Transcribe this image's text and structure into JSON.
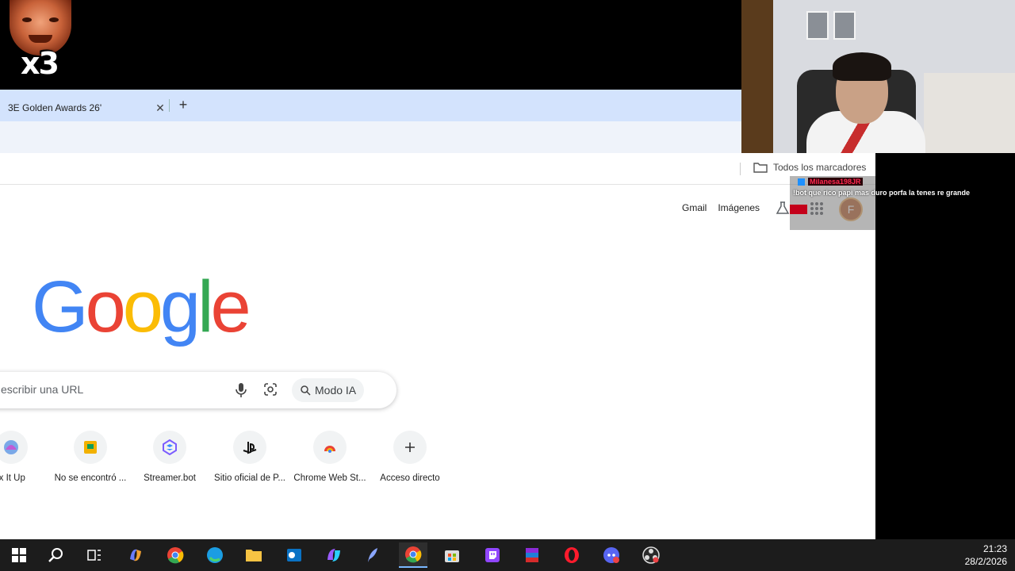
{
  "emote": {
    "multiplier": "x3"
  },
  "browser": {
    "tab": {
      "title": "3E Golden Awards 26'",
      "close": "✕",
      "new_tab": "+"
    },
    "bookmarks": {
      "all_label": "Todos los marcadores"
    }
  },
  "google": {
    "links": {
      "gmail": "Gmail",
      "images": "Imágenes"
    },
    "avatar_letter": "F",
    "logo": [
      "G",
      "o",
      "o",
      "g",
      "l",
      "e"
    ],
    "logo_colors": [
      "#4285F4",
      "#EA4335",
      "#FBBC05",
      "#4285F4",
      "#34A853",
      "#EA4335"
    ],
    "search": {
      "placeholder": "escribir una URL",
      "ai_mode": "Modo IA"
    },
    "shortcuts": [
      {
        "label": "ix It Up",
        "icon": "fix-it-up-icon"
      },
      {
        "label": "No se encontró ...",
        "icon": "google-sheets-icon"
      },
      {
        "label": "Streamer.bot",
        "icon": "streamerbot-icon"
      },
      {
        "label": "Sitio oficial de P...",
        "icon": "playstation-icon"
      },
      {
        "label": "Chrome Web St...",
        "icon": "chrome-web-store-icon"
      },
      {
        "label": "Acceso directo",
        "icon": "add-icon"
      }
    ]
  },
  "chat": {
    "username": "Milanesa198JR",
    "message": "!bot que rico papi mas duro porfa la tenes re grande"
  },
  "taskbar": {
    "icons": [
      "windows-start-icon",
      "search-icon",
      "task-view-icon",
      "copilot-icon",
      "chrome-icon",
      "edge-icon",
      "file-explorer-icon",
      "outlook-icon",
      "m365-icon",
      "feather-app-icon",
      "chrome-active-icon",
      "store-icon",
      "twitch-icon",
      "winrar-icon",
      "opera-icon",
      "discord-icon",
      "obs-icon"
    ],
    "time": "21:23",
    "date": "28/2/2026"
  }
}
